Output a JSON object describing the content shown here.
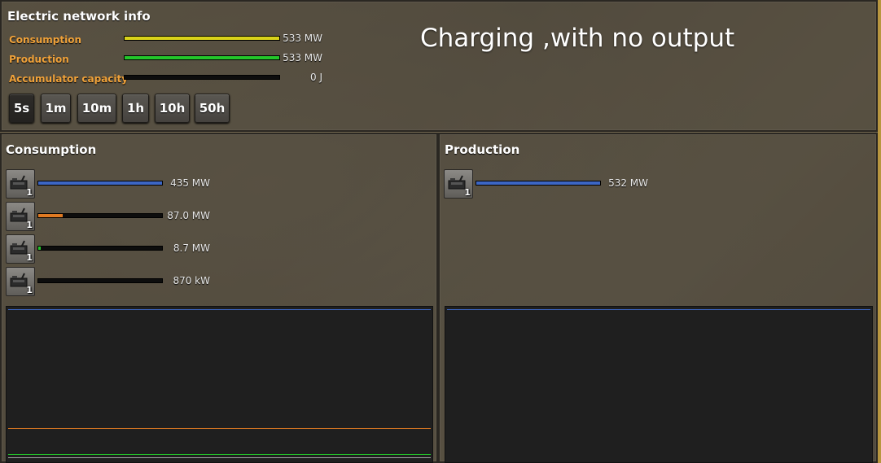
{
  "overlay_caption": "Charging ,with no output",
  "network": {
    "title": "Electric network info",
    "stats": [
      {
        "label": "Consumption",
        "value": "533 MW",
        "fill_fraction": 1.0,
        "color": "#d8d21a"
      },
      {
        "label": "Production",
        "value": "533 MW",
        "fill_fraction": 1.0,
        "color": "#23c52a"
      },
      {
        "label": "Accumulator capacity",
        "value": "0 J",
        "fill_fraction": 0.0,
        "color": "#23c52a"
      }
    ],
    "time_buttons": [
      "5s",
      "1m",
      "10m",
      "1h",
      "10h",
      "50h"
    ],
    "selected_time": "5s"
  },
  "consumption": {
    "title": "Consumption",
    "items": [
      {
        "icon": "machine-icon",
        "count": "1",
        "value": "435 MW",
        "fill_fraction": 1.0,
        "color": "#3c66c4"
      },
      {
        "icon": "machine-icon",
        "count": "1",
        "value": "87.0 MW",
        "fill_fraction": 0.2,
        "color": "#e07a22"
      },
      {
        "icon": "machine-icon",
        "count": "1",
        "value": "8.7 MW",
        "fill_fraction": 0.02,
        "color": "#23c52a"
      },
      {
        "icon": "machine-icon",
        "count": "1",
        "value": "870 kW",
        "fill_fraction": 0.0,
        "color": "#888888"
      }
    ],
    "graph_lines": [
      {
        "color": "#3c66c4",
        "level": 1.0
      },
      {
        "color": "#e07a22",
        "level": 0.2
      },
      {
        "color": "#23c52a",
        "level": 0.02
      },
      {
        "color": "#a0a0a0",
        "level": 0.002
      }
    ]
  },
  "production": {
    "title": "Production",
    "items": [
      {
        "icon": "generator-icon",
        "count": "1",
        "value": "532 MW",
        "fill_fraction": 1.0,
        "color": "#3c66c4"
      }
    ],
    "graph_lines": [
      {
        "color": "#3c66c4",
        "level": 1.0
      }
    ]
  }
}
